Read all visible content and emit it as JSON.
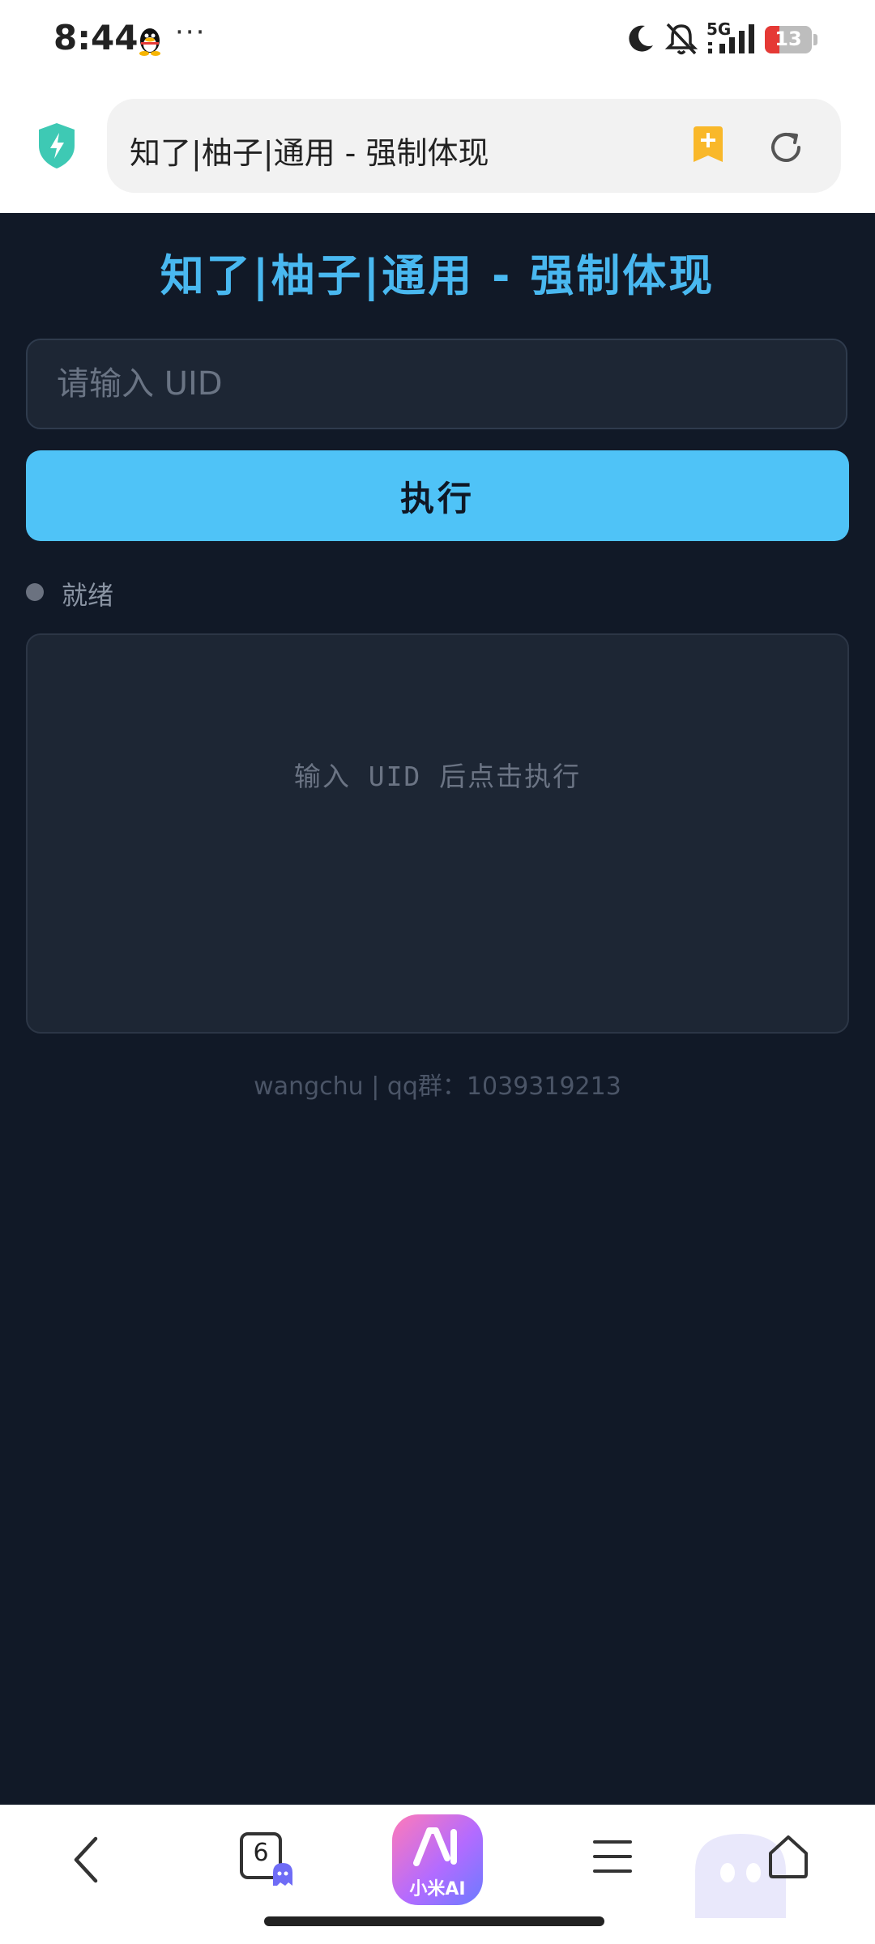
{
  "status_bar": {
    "time": "8:44",
    "more": "···",
    "network": "5G",
    "battery": "13",
    "battery_color": "#e53935"
  },
  "browser": {
    "url_text": "知了|柚子|通用 - 强制体现",
    "icons": [
      "shield-lightning-icon",
      "bookmark-add-icon",
      "reload-icon"
    ]
  },
  "page": {
    "title": "知了|柚子|通用 - 强制体现",
    "uid_placeholder": "请输入 UID",
    "uid_value": "",
    "execute_label": "执行",
    "status": "就绪",
    "output_placeholder": "输入 UID 后点击执行",
    "footer": "wangchu | qq群：1039319213",
    "accent_color": "#4fc3f7",
    "background_color": "#111927"
  },
  "bottom_nav": {
    "tabs_count": "6",
    "ai_label": "小米AI",
    "items": [
      "back-icon",
      "tabs-icon",
      "xiaomi-ai-button",
      "menu-icon",
      "home-icon"
    ]
  }
}
